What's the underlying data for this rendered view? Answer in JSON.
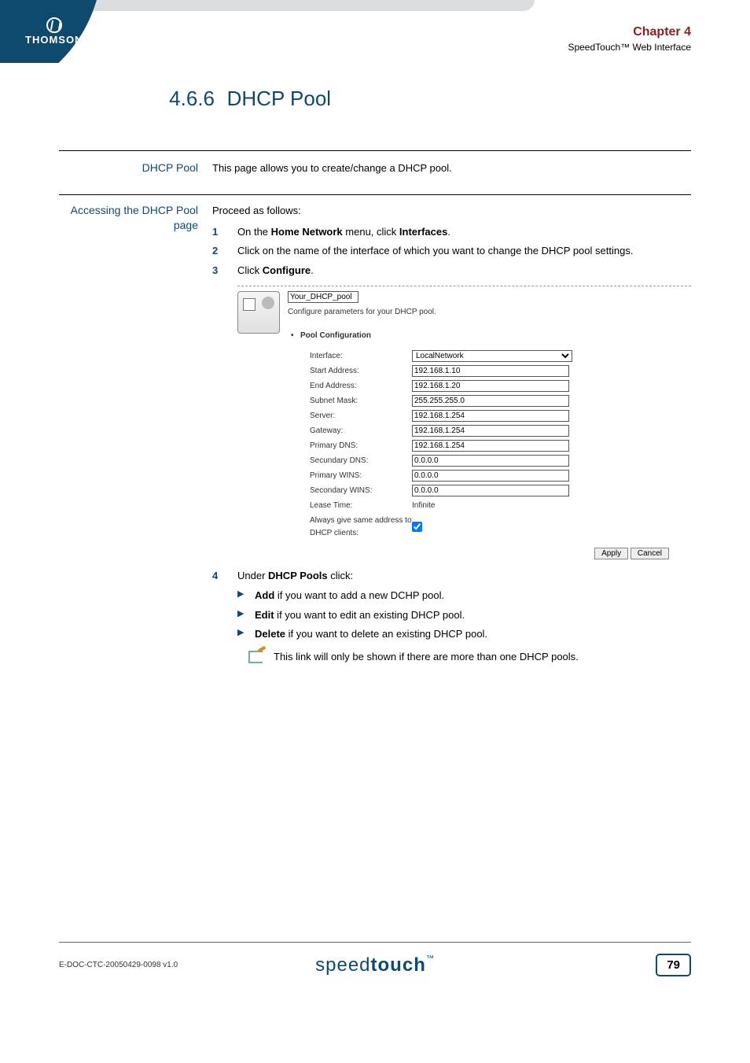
{
  "header": {
    "brand": "THOMSON",
    "chapter": "Chapter 4",
    "subtitle": "SpeedTouch™ Web Interface"
  },
  "section": {
    "number": "4.6.6",
    "title": "DHCP Pool"
  },
  "intro": {
    "label": "DHCP Pool",
    "text": "This page allows you to create/change a DHCP pool."
  },
  "access": {
    "label": "Accessing the DHCP Pool page",
    "lead": "Proceed as follows:",
    "steps": {
      "s1": {
        "num": "1",
        "pre": "On the ",
        "b1": "Home Network",
        "mid": " menu, click ",
        "b2": "Interfaces",
        "post": "."
      },
      "s2": {
        "num": "2",
        "text": "Click on the name of the interface of which you want to change the DHCP pool settings."
      },
      "s3": {
        "num": "3",
        "pre": "Click ",
        "b1": "Configure",
        "post": "."
      },
      "s4": {
        "num": "4",
        "pre": "Under ",
        "b1": "DHCP Pools",
        "post": " click:"
      }
    },
    "sub": {
      "add": {
        "b": "Add",
        "rest": " if you want to add a new DCHP pool."
      },
      "edit": {
        "b": "Edit",
        "rest": " if you want to edit an existing DHCP pool."
      },
      "delete": {
        "b": "Delete",
        "rest": " if you want to delete an existing DHCP pool."
      }
    },
    "note": "This link will only be shown if there are more than one DHCP pools."
  },
  "screenshot": {
    "pool_name": "Your_DHCP_pool",
    "subtitle": "Configure parameters for your DHCP pool.",
    "config_header": "Pool Configuration",
    "fields": {
      "interface": {
        "label": "Interface:",
        "value": "LocalNetwork"
      },
      "start_address": {
        "label": "Start Address:",
        "value": "192.168.1.10"
      },
      "end_address": {
        "label": "End Address:",
        "value": "192.168.1.20"
      },
      "subnet_mask": {
        "label": "Subnet Mask:",
        "value": "255.255.255.0"
      },
      "server": {
        "label": "Server:",
        "value": "192.168.1.254"
      },
      "gateway": {
        "label": "Gateway:",
        "value": "192.168.1.254"
      },
      "primary_dns": {
        "label": "Primary DNS:",
        "value": "192.168.1.254"
      },
      "secondary_dns": {
        "label": "Secundary DNS:",
        "value": "0.0.0.0"
      },
      "primary_wins": {
        "label": "Primary WINS:",
        "value": "0.0.0.0"
      },
      "secondary_wins": {
        "label": "Secondary WINS:",
        "value": "0.0.0.0"
      },
      "lease_time": {
        "label": "Lease Time:",
        "value": "Infinite"
      },
      "always_same": {
        "label": "Always give same address to DHCP clients:"
      }
    },
    "buttons": {
      "apply": "Apply",
      "cancel": "Cancel"
    }
  },
  "footer": {
    "doc_id": "E-DOC-CTC-20050429-0098 v1.0",
    "product_a": "speed",
    "product_b": "touch",
    "tm": "™",
    "page": "79"
  }
}
